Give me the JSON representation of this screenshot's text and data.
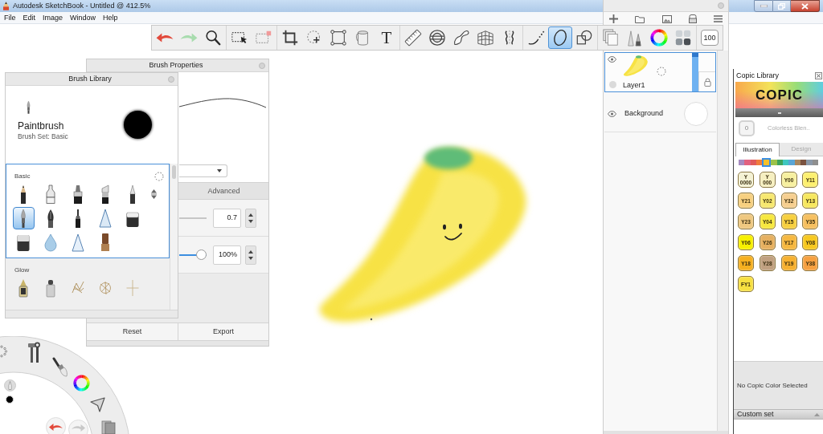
{
  "window": {
    "title": "Autodesk SketchBook - Untitled @ 412.5%"
  },
  "menu": [
    "File",
    "Edit",
    "Image",
    "Window",
    "Help"
  ],
  "toolbar": {
    "groups": [
      {
        "tools": [
          {
            "kind": "undo",
            "selected": false
          },
          {
            "kind": "redo",
            "selected": false
          },
          {
            "kind": "zoom",
            "selected": false
          }
        ]
      },
      {
        "tools": [
          {
            "kind": "select",
            "selected": false
          },
          {
            "kind": "transform",
            "selected": false
          }
        ]
      },
      {
        "tools": [
          {
            "kind": "crop",
            "selected": false
          },
          {
            "kind": "move",
            "selected": false
          },
          {
            "kind": "distort",
            "selected": false
          },
          {
            "kind": "fill",
            "selected": false
          },
          {
            "kind": "text",
            "label": "T",
            "selected": false
          }
        ]
      },
      {
        "tools": [
          {
            "kind": "ruler",
            "selected": false
          },
          {
            "kind": "ellipse",
            "selected": false
          },
          {
            "kind": "curve",
            "selected": false
          },
          {
            "kind": "perspective",
            "selected": false
          },
          {
            "kind": "symmetry",
            "selected": false
          }
        ]
      },
      {
        "tools": [
          {
            "kind": "stroke",
            "selected": false
          },
          {
            "kind": "oval",
            "selected": true
          },
          {
            "kind": "shapes",
            "selected": false
          }
        ]
      },
      {
        "tools": [
          {
            "kind": "layers",
            "selected": false
          },
          {
            "kind": "brushes",
            "selected": false
          },
          {
            "kind": "colorwheel",
            "selected": false
          },
          {
            "kind": "swatches",
            "selected": false
          }
        ]
      },
      {
        "tools": [
          {
            "kind": "size",
            "label": "100",
            "selected": false
          }
        ]
      }
    ]
  },
  "layers_panel": {
    "layers": [
      {
        "name": "Layer1",
        "selected": true,
        "visible": true,
        "level": 1
      },
      {
        "name": "Background",
        "selected": false,
        "visible": true
      }
    ]
  },
  "brush_properties": {
    "title": "Brush Properties",
    "tabs": [
      {
        "label": "Advanced",
        "selected": false
      }
    ],
    "sliders": [
      {
        "value": "0.7"
      },
      {
        "value": "100%",
        "level": 1
      }
    ],
    "buttons": [
      "Reset",
      "Export"
    ]
  },
  "brush_library": {
    "title": "Brush Library",
    "current": {
      "name": "Paintbrush",
      "set": "Brush Set: Basic"
    },
    "sections": [
      {
        "title": "Basic",
        "selected": true,
        "brushes": [
          {
            "kind": "pencil",
            "selected": false
          },
          {
            "kind": "techpen",
            "selected": false
          },
          {
            "kind": "marker",
            "selected": false
          },
          {
            "kind": "chisel",
            "selected": false
          },
          {
            "kind": "ballpoint",
            "selected": false
          },
          {
            "kind": "paintbrush",
            "selected": true
          },
          {
            "kind": "inkpen",
            "selected": false
          },
          {
            "kind": "felttip",
            "selected": false
          },
          {
            "kind": "airbrush",
            "selected": false
          },
          {
            "kind": "eraser",
            "selected": false
          },
          {
            "kind": "softeraser",
            "selected": false
          },
          {
            "kind": "water",
            "selected": false
          },
          {
            "kind": "triangle",
            "selected": false
          },
          {
            "kind": "stamp",
            "selected": false
          }
        ]
      },
      {
        "title": "Glow",
        "selected": false,
        "brushes": [
          {
            "kind": "glowpen",
            "selected": false
          },
          {
            "kind": "glowmarker",
            "selected": false
          },
          {
            "kind": "scribble",
            "selected": false
          },
          {
            "kind": "swirl",
            "selected": false
          },
          {
            "kind": "sparkle",
            "selected": false
          }
        ]
      }
    ]
  },
  "copic_library": {
    "title": "Copic Library",
    "logo": "COPIC",
    "blender": {
      "code": "0",
      "label": "Colorless Blen.."
    },
    "tabs": [
      {
        "label": "Illustration",
        "selected": true
      },
      {
        "label": "Design",
        "selected": false
      }
    ],
    "families": [
      {
        "color": "#a68bc1",
        "selected": false
      },
      {
        "color": "#e2617f",
        "selected": false
      },
      {
        "color": "#e05a5a",
        "selected": false
      },
      {
        "color": "#f07c3c",
        "selected": false
      },
      {
        "color": "#f5c02a",
        "selected": true
      },
      {
        "color": "#9cc24a",
        "selected": false
      },
      {
        "color": "#3fa35a",
        "selected": false
      },
      {
        "color": "#3fc7c0",
        "selected": false
      },
      {
        "color": "#5aa6d6",
        "selected": false
      },
      {
        "color": "#a9875f",
        "selected": false
      },
      {
        "color": "#7a5240",
        "selected": false
      },
      {
        "color": "#8a98a8",
        "selected": false
      },
      {
        "color": "#8f8f8f",
        "selected": false
      }
    ],
    "swatches": [
      {
        "code": "Y 0000",
        "color": "#f4f2d4",
        "selected": false
      },
      {
        "code": "Y 000",
        "color": "#f6efc0",
        "selected": false
      },
      {
        "code": "Y00",
        "color": "#f7f0a0",
        "selected": false
      },
      {
        "code": "Y11",
        "color": "#fdf070",
        "selected": false
      },
      {
        "code": "Y21",
        "color": "#f7d080",
        "selected": false
      },
      {
        "code": "Y02",
        "color": "#f7e870",
        "selected": false
      },
      {
        "code": "Y32",
        "color": "#f6cf90",
        "selected": false
      },
      {
        "code": "Y13",
        "color": "#f7e860",
        "selected": false
      },
      {
        "code": "Y23",
        "color": "#efc880",
        "selected": false
      },
      {
        "code": "Y04",
        "color": "#f7e840",
        "selected": false
      },
      {
        "code": "Y15",
        "color": "#f7d040",
        "selected": false
      },
      {
        "code": "Y35",
        "color": "#f6c060",
        "selected": false
      },
      {
        "code": "Y06",
        "color": "#f7f000",
        "selected": false
      },
      {
        "code": "Y26",
        "color": "#e6b060",
        "selected": false
      },
      {
        "code": "Y17",
        "color": "#f6b840",
        "selected": false
      },
      {
        "code": "Y08",
        "color": "#f7c820",
        "selected": false
      },
      {
        "code": "Y18",
        "color": "#f6b020",
        "selected": false
      },
      {
        "code": "Y28",
        "color": "#c0a080",
        "selected": false
      },
      {
        "code": "Y19",
        "color": "#f6b030",
        "selected": false
      },
      {
        "code": "Y38",
        "color": "#f6a040",
        "selected": false
      },
      {
        "code": "FY1",
        "color": "#f7e040",
        "selected": false
      }
    ],
    "status": "No Copic Color Selected",
    "custom_set": {
      "label": "Custom set",
      "expanded": false
    }
  }
}
